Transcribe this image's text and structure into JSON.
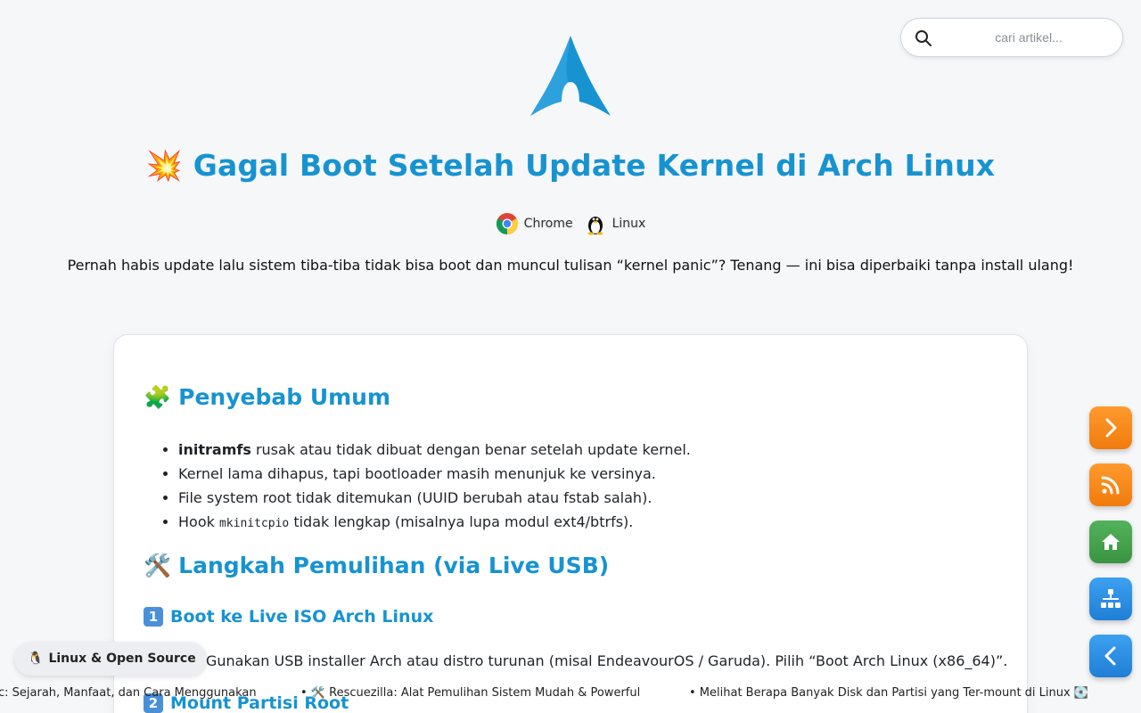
{
  "search": {
    "placeholder": "cari artikel..."
  },
  "title": "💥 Gagal Boot Setelah Update Kernel di Arch Linux",
  "tags": [
    {
      "label": "Chrome",
      "icon": "chrome-icon"
    },
    {
      "label": "Linux",
      "icon": "tux-icon"
    }
  ],
  "lead": "Pernah habis update lalu sistem tiba-tiba tidak bisa boot dan muncul tulisan “kernel panic”? Tenang — ini bisa diperbaiki tanpa install ulang!",
  "article": {
    "section1": {
      "emoji": "🧩",
      "heading": "Penyebab Umum"
    },
    "causes": {
      "c1_bold": "initramfs",
      "c1_rest": " rusak atau tidak dibuat dengan benar setelah update kernel.",
      "c2": "Kernel lama dihapus, tapi bootloader masih menunjuk ke versinya.",
      "c3": "File system root tidak ditemukan (UUID berubah atau fstab salah).",
      "c4_pre": "Hook ",
      "c4_code": "mkinitcpio",
      "c4_rest": " tidak lengkap (misalnya lupa modul ext4/btrfs)."
    },
    "section2": {
      "emoji": "🛠️",
      "heading": "Langkah Pemulihan (via Live USB)"
    },
    "step1": {
      "num": "1",
      "heading": "Boot ke Live ISO Arch Linux",
      "text": "Gunakan USB installer Arch atau distro turunan (misal EndeavourOS / Garuda). Pilih “Boot Arch Linux (x86_64)”."
    },
    "step2": {
      "num": "2",
      "heading": "Mount Partisi Root"
    }
  },
  "pill": {
    "icon": "🐧",
    "label": "Linux & Open Source"
  },
  "ticker": {
    "item1": "c: Sejarah, Manfaat, dan Cara Menggunakan",
    "item2": "• 🛠️ Rescuezilla: Alat Pemulihan Sistem Mudah & Powerful",
    "item3": "• Melihat Berapa Banyak Disk dan Partisi yang Ter-mount di Linux 💽"
  },
  "colors": {
    "accent": "#1793d1",
    "orange": "#f58a1f",
    "green": "#45a34d",
    "blue": "#2b8de3"
  }
}
